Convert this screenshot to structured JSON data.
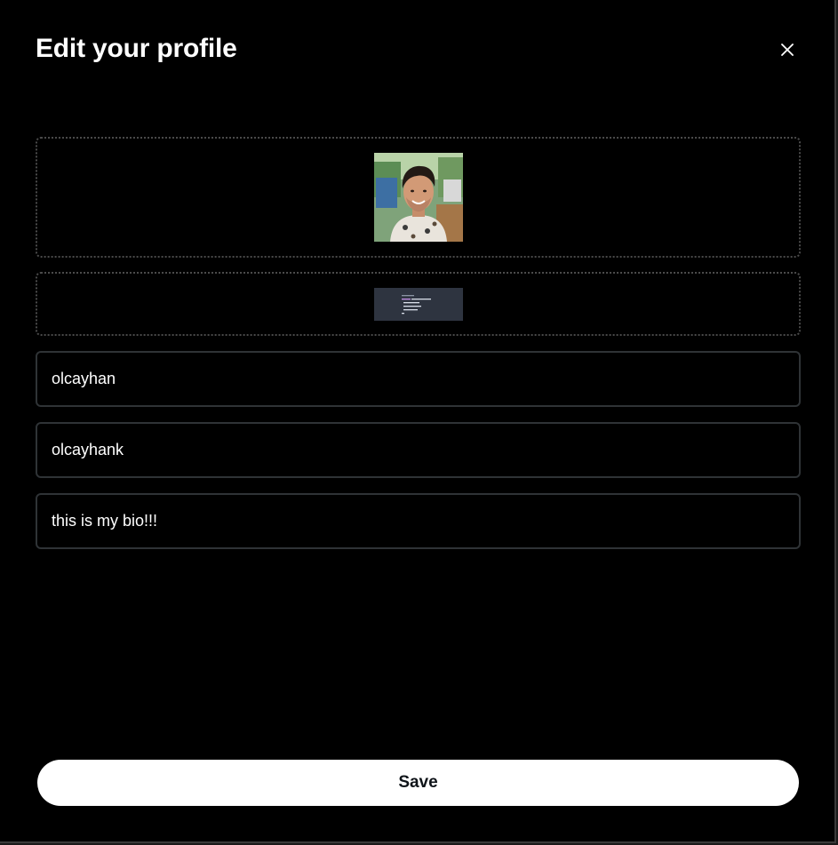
{
  "modal": {
    "title": "Edit your profile",
    "close_icon": "close-icon"
  },
  "media": {
    "avatar_icon": "profile-photo",
    "banner_icon": "banner-code-image"
  },
  "fields": {
    "name_value": "olcayhan",
    "username_value": "olcayhank",
    "bio_value": "this is my bio!!!"
  },
  "actions": {
    "save_label": "Save"
  },
  "colors": {
    "background": "#000000",
    "field_border": "#2f3336",
    "save_button_bg": "#ffffff",
    "save_button_text": "#0f1419"
  }
}
